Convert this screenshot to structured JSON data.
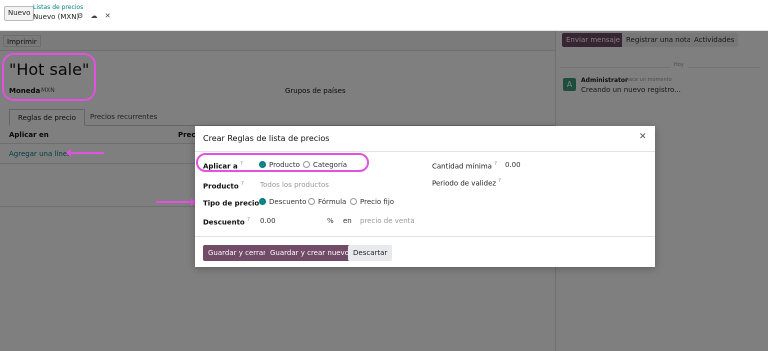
{
  "topbar": {
    "new_label": "Nuevo",
    "breadcrumb_parent": "Listas de precios",
    "breadcrumb_current": "Nuevo (MXN)"
  },
  "form": {
    "print_label": "Imprimir",
    "title": "\"Hot sale\"",
    "moneda_label": "Moneda",
    "moneda_value": "MXN",
    "grupos_label": "Grupos de países",
    "tabs": [
      {
        "label": "Reglas de precio"
      },
      {
        "label": "Precios recurrentes"
      }
    ],
    "col_aplicar": "Aplicar en",
    "col_precio": "Precio",
    "add_line": "Agregar una línea"
  },
  "chatter": {
    "send_label": "Enviar mensaje",
    "note_label": "Registrar una nota",
    "activities_label": "Actividades",
    "day": "Hoy",
    "avatar_letter": "A",
    "author": "Administrator",
    "time": "hace un momento",
    "message": "Creando un nuevo registro..."
  },
  "modal": {
    "title": "Crear Reglas de lista de precios",
    "close_icon": "close-icon",
    "aplicar_label": "Aplicar a",
    "aplicar_options": [
      {
        "label": "Producto",
        "checked": true
      },
      {
        "label": "Categoría",
        "checked": false
      }
    ],
    "producto_label": "Producto",
    "producto_placeholder": "Todos los productos",
    "tipo_label": "Tipo de precio",
    "tipo_options": [
      {
        "label": "Descuento",
        "checked": true
      },
      {
        "label": "Fórmula",
        "checked": false
      },
      {
        "label": "Precio fijo",
        "checked": false
      }
    ],
    "descuento_label": "Descuento",
    "descuento_value": "0.00",
    "percent": "%",
    "en": "en",
    "precio_venta": "precio de venta",
    "cantidad_label": "Cantidad mínima",
    "cantidad_value": "0.00",
    "periodo_label": "Periodo de validez",
    "save_label": "Guardar y cerrar",
    "save_new_label": "Guardar y crear nuevo",
    "discard_label": "Descartar"
  },
  "colors": {
    "brand": "#714b67",
    "teal": "#017e84",
    "highlight": "#e052e0"
  }
}
